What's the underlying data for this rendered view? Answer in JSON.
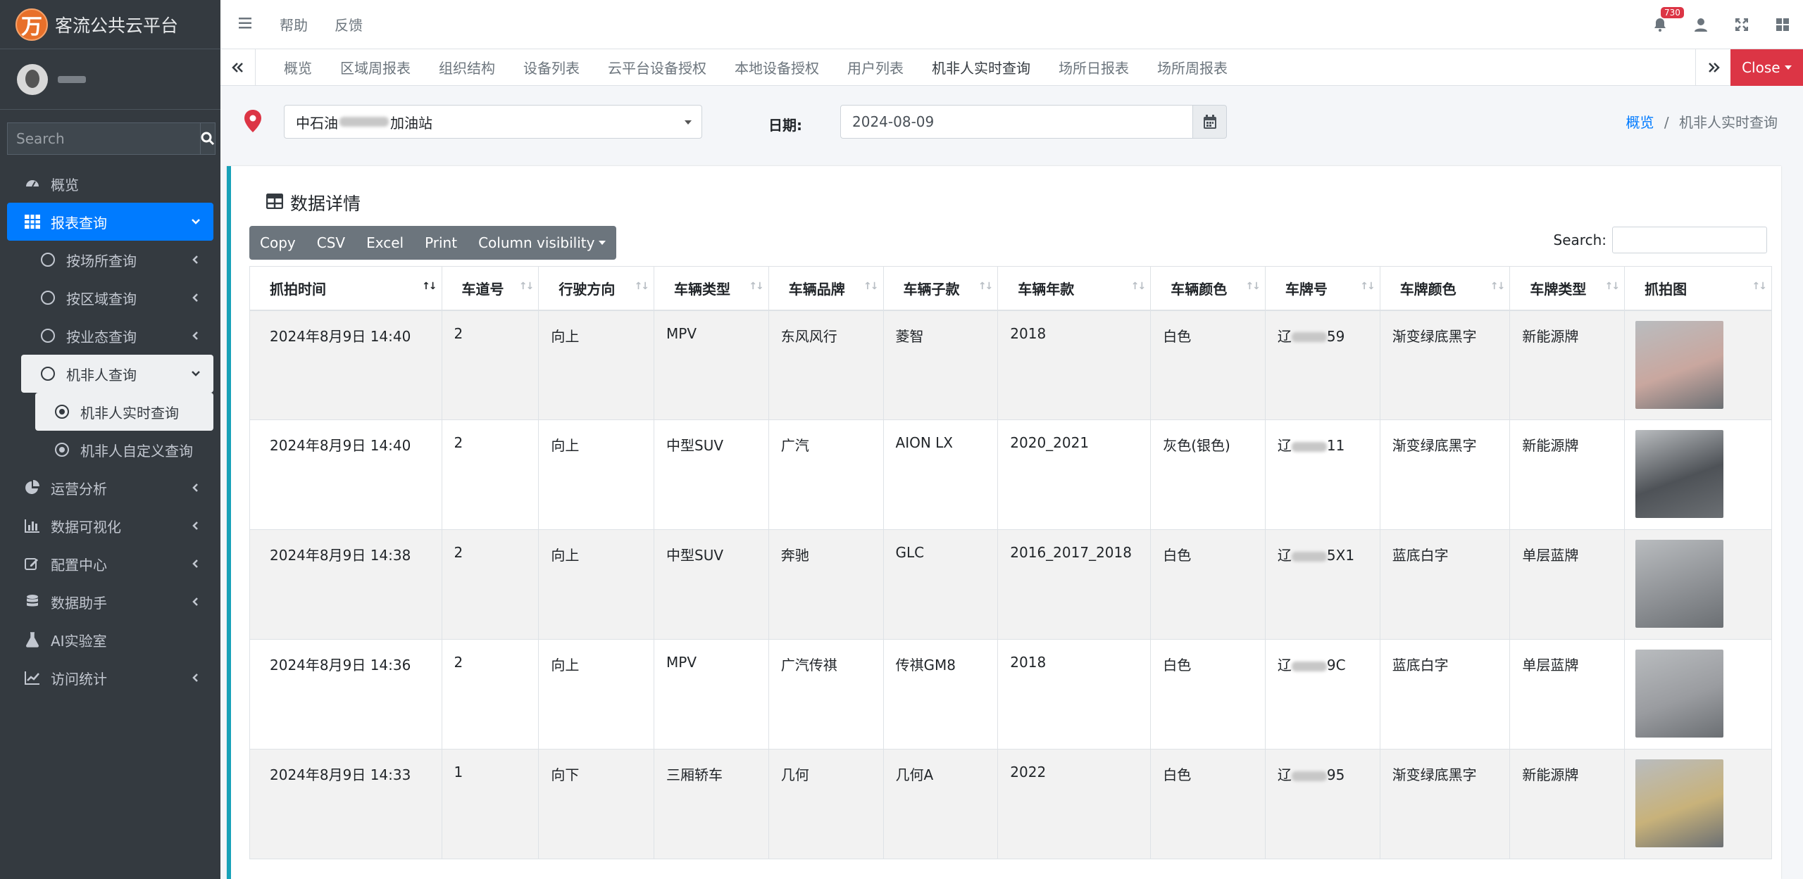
{
  "app": {
    "title": "客流公共云平台",
    "logo_char": "万"
  },
  "sidebar": {
    "search_placeholder": "Search",
    "items": [
      {
        "label": "概览",
        "icon": "dashboard-icon"
      },
      {
        "label": "报表查询",
        "icon": "grid-icon"
      },
      {
        "label": "按场所查询"
      },
      {
        "label": "按区域查询"
      },
      {
        "label": "按业态查询"
      },
      {
        "label": "机非人查询"
      },
      {
        "label": "机非人实时查询"
      },
      {
        "label": "机非人自定义查询"
      },
      {
        "label": "运营分析",
        "icon": "pie-chart-icon"
      },
      {
        "label": "数据可视化",
        "icon": "bar-chart-icon"
      },
      {
        "label": "配置中心",
        "icon": "edit-icon"
      },
      {
        "label": "数据助手",
        "icon": "database-icon"
      },
      {
        "label": "AI实验室",
        "icon": "flask-icon"
      },
      {
        "label": "访问统计",
        "icon": "line-chart-icon"
      }
    ]
  },
  "topbar": {
    "help": "帮助",
    "feedback": "反馈",
    "notification_count": "730"
  },
  "tabs": [
    "概览",
    "区域周报表",
    "组织结构",
    "设备列表",
    "云平台设备授权",
    "本地设备授权",
    "用户列表",
    "机非人实时查询",
    "场所日报表",
    "场所周报表"
  ],
  "tabs_close": "Close",
  "filter": {
    "station_prefix": "中石油",
    "station_suffix": "加油站",
    "date_label": "日期:",
    "date_value": "2024-08-09"
  },
  "breadcrumb": {
    "home": "概览",
    "sep": "/",
    "current": "机非人实时查询"
  },
  "card": {
    "title": "数据详情"
  },
  "toolbar": {
    "copy": "Copy",
    "csv": "CSV",
    "excel": "Excel",
    "print": "Print",
    "colvis": "Column visibility"
  },
  "table_search_label": "Search:",
  "table": {
    "headers": [
      "抓拍时间",
      "车道号",
      "行驶方向",
      "车辆类型",
      "车辆品牌",
      "车辆子款",
      "车辆年款",
      "车辆颜色",
      "车牌号",
      "车牌颜色",
      "车牌类型",
      "抓拍图"
    ],
    "rows": [
      {
        "time": "2024年8月9日 14:40",
        "lane": "2",
        "dir": "向上",
        "type": "MPV",
        "brand": "东风风行",
        "sub": "菱智",
        "year": "2018",
        "color": "白色",
        "plate_a": "辽",
        "plate_b": "59",
        "plate_color": "渐变绿底黑字",
        "plate_type": "新能源牌",
        "img": "#c9a79f"
      },
      {
        "time": "2024年8月9日 14:40",
        "lane": "2",
        "dir": "向上",
        "type": "中型SUV",
        "brand": "广汽",
        "sub": "AION LX",
        "year": "2020_2021",
        "color": "灰色(银色)",
        "plate_a": "辽",
        "plate_b": "11",
        "plate_color": "渐变绿底黑字",
        "plate_type": "新能源牌",
        "img": "#4e5257"
      },
      {
        "time": "2024年8月9日 14:38",
        "lane": "2",
        "dir": "向上",
        "type": "中型SUV",
        "brand": "奔驰",
        "sub": "GLC",
        "year": "2016_2017_2018",
        "color": "白色",
        "plate_a": "辽",
        "plate_b": "5X1",
        "plate_color": "蓝底白字",
        "plate_type": "单层蓝牌",
        "img": "#8f9296"
      },
      {
        "time": "2024年8月9日 14:36",
        "lane": "2",
        "dir": "向上",
        "type": "MPV",
        "brand": "广汽传祺",
        "sub": "传祺GM8",
        "year": "2018",
        "color": "白色",
        "plate_a": "辽",
        "plate_b": "9C",
        "plate_color": "蓝底白字",
        "plate_type": "单层蓝牌",
        "img": "#9a9ca0"
      },
      {
        "time": "2024年8月9日 14:33",
        "lane": "1",
        "dir": "向下",
        "type": "三厢轿车",
        "brand": "几何",
        "sub": "几何A",
        "year": "2022",
        "color": "白色",
        "plate_a": "辽",
        "plate_b": "95",
        "plate_color": "渐变绿底黑字",
        "plate_type": "新能源牌",
        "img": "#c8b27a"
      }
    ]
  },
  "colors": {
    "primary": "#007bff",
    "danger": "#dc3545",
    "sidebar": "#343a40",
    "accent": "#17a2b8"
  }
}
